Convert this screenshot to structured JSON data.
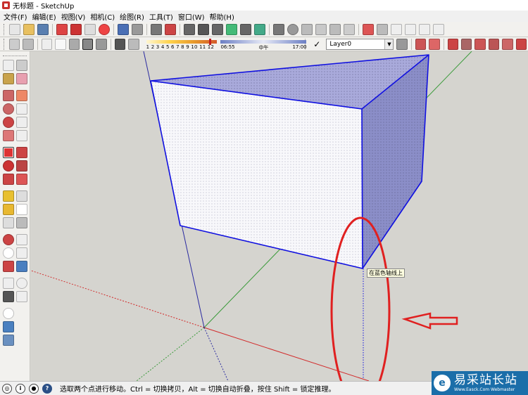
{
  "window": {
    "title": "无标题 - SketchUp"
  },
  "menu": [
    "文件(F)",
    "编辑(E)",
    "视图(V)",
    "相机(C)",
    "绘图(R)",
    "工具(T)",
    "窗口(W)",
    "帮助(H)"
  ],
  "shadow_slider": {
    "numbers": "1 2 3 4 5 6 7 8 9 10 11 12",
    "value": 0.92
  },
  "time_slider": {
    "start": "06:55",
    "mid": "中午",
    "end": "17:00"
  },
  "layer": {
    "current": "Layer0",
    "dropdown_glyph": "▼",
    "check_glyph": "✓"
  },
  "viewport": {
    "tooltip": "在蓝色轴线上"
  },
  "status": {
    "text": "选取两个点进行移动。Ctrl = 切换拷贝，Alt = 切换自动折叠，按住 Shift = 锁定推理。"
  },
  "watermark": {
    "title": "易采站长站",
    "url": "Www.Easck.Com Webmaster",
    "glyph": "e"
  },
  "icons": {
    "status_icons": [
      {
        "name": "geo-location-icon",
        "glyph": "◎"
      },
      {
        "name": "info-icon",
        "glyph": "i"
      },
      {
        "name": "user-icon",
        "glyph": "●"
      },
      {
        "name": "help-icon",
        "glyph": "?"
      }
    ]
  },
  "colors": {
    "axis_red": "#d22a2a",
    "axis_green": "#3a9a3a",
    "axis_blue": "#2a2aa0",
    "edge_blue": "#1010e0",
    "annotation_red": "#e02020",
    "face_front": "#f8f8fb",
    "face_side": "#8b8ec8",
    "face_top": "#a9aadb"
  }
}
